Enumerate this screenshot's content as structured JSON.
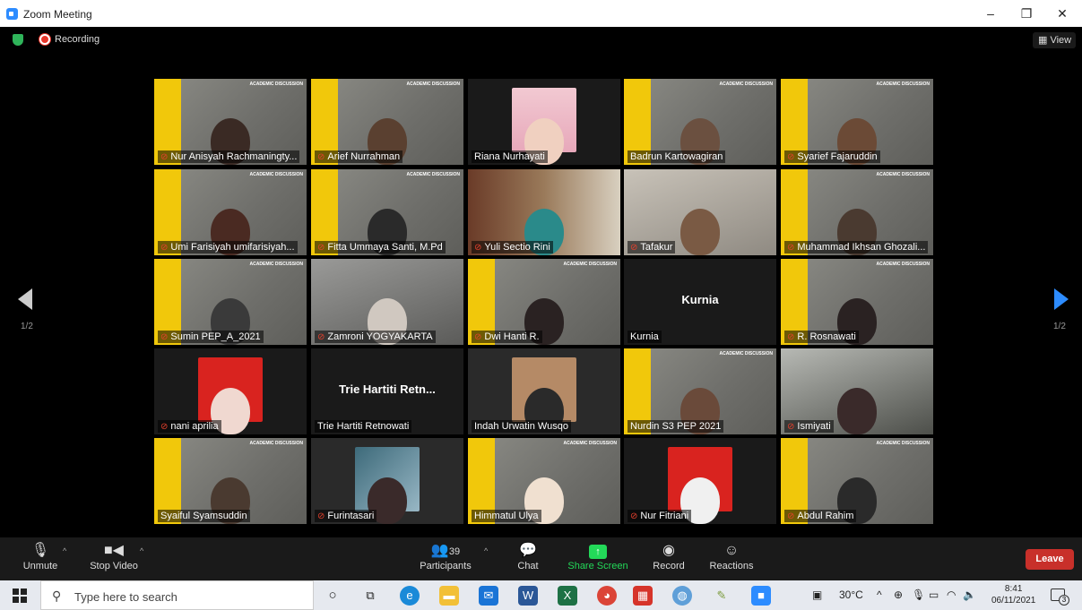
{
  "window": {
    "title": "Zoom Meeting",
    "minimize": "–",
    "maximize": "❐",
    "close": "✕"
  },
  "topbar": {
    "recording": "Recording",
    "view": "View"
  },
  "pager": {
    "left": "1/2",
    "right": "1/2"
  },
  "participants": [
    {
      "name": "Nur Anisyah Rachmaningty...",
      "muted": true
    },
    {
      "name": "Arief Nurrahman",
      "muted": true
    },
    {
      "name": "Riana Nurhayati",
      "muted": false
    },
    {
      "name": "Badrun Kartowagiran",
      "muted": false
    },
    {
      "name": "Syarief Fajaruddin",
      "muted": true
    },
    {
      "name": "Umi Farisiyah umifarisiyah...",
      "muted": true
    },
    {
      "name": "Fitta Ummaya Santi, M.Pd",
      "muted": true
    },
    {
      "name": "Yuli Sectio Rini",
      "muted": true
    },
    {
      "name": "Tafakur",
      "muted": true
    },
    {
      "name": "Muhammad Ikhsan Ghozali...",
      "muted": true
    },
    {
      "name": "Sumin PEP_A_2021",
      "muted": true
    },
    {
      "name": "Zamroni YOGYAKARTA",
      "muted": true
    },
    {
      "name": "Dwi Hanti R.",
      "muted": true
    },
    {
      "name": "Kurnia",
      "muted": false,
      "big": "Kurnia"
    },
    {
      "name": "R. Rosnawati",
      "muted": true
    },
    {
      "name": "nani aprilia",
      "muted": true
    },
    {
      "name": "Trie Hartiti Retnowati",
      "muted": false,
      "big": "Trie Hartiti Retn..."
    },
    {
      "name": "Indah Urwatin Wusqo",
      "muted": false
    },
    {
      "name": "Nurdin S3 PEP 2021",
      "muted": false
    },
    {
      "name": "Ismiyati",
      "muted": true
    },
    {
      "name": "Syaiful Syamsuddin",
      "muted": false
    },
    {
      "name": "Furintasari",
      "muted": true
    },
    {
      "name": "Himmatul Ulya",
      "muted": false
    },
    {
      "name": "Nur Fitriani",
      "muted": true
    },
    {
      "name": "Abdul Rahim",
      "muted": true
    }
  ],
  "controls": {
    "unmute": "Unmute",
    "stop_video": "Stop Video",
    "participants": "Participants",
    "participants_count": "39",
    "chat": "Chat",
    "share_screen": "Share Screen",
    "record": "Record",
    "reactions": "Reactions",
    "leave": "Leave"
  },
  "taskbar": {
    "search_placeholder": "Type here to search",
    "temperature": "30°C",
    "time": "8:41",
    "date": "06/11/2021",
    "notifications": "3"
  }
}
